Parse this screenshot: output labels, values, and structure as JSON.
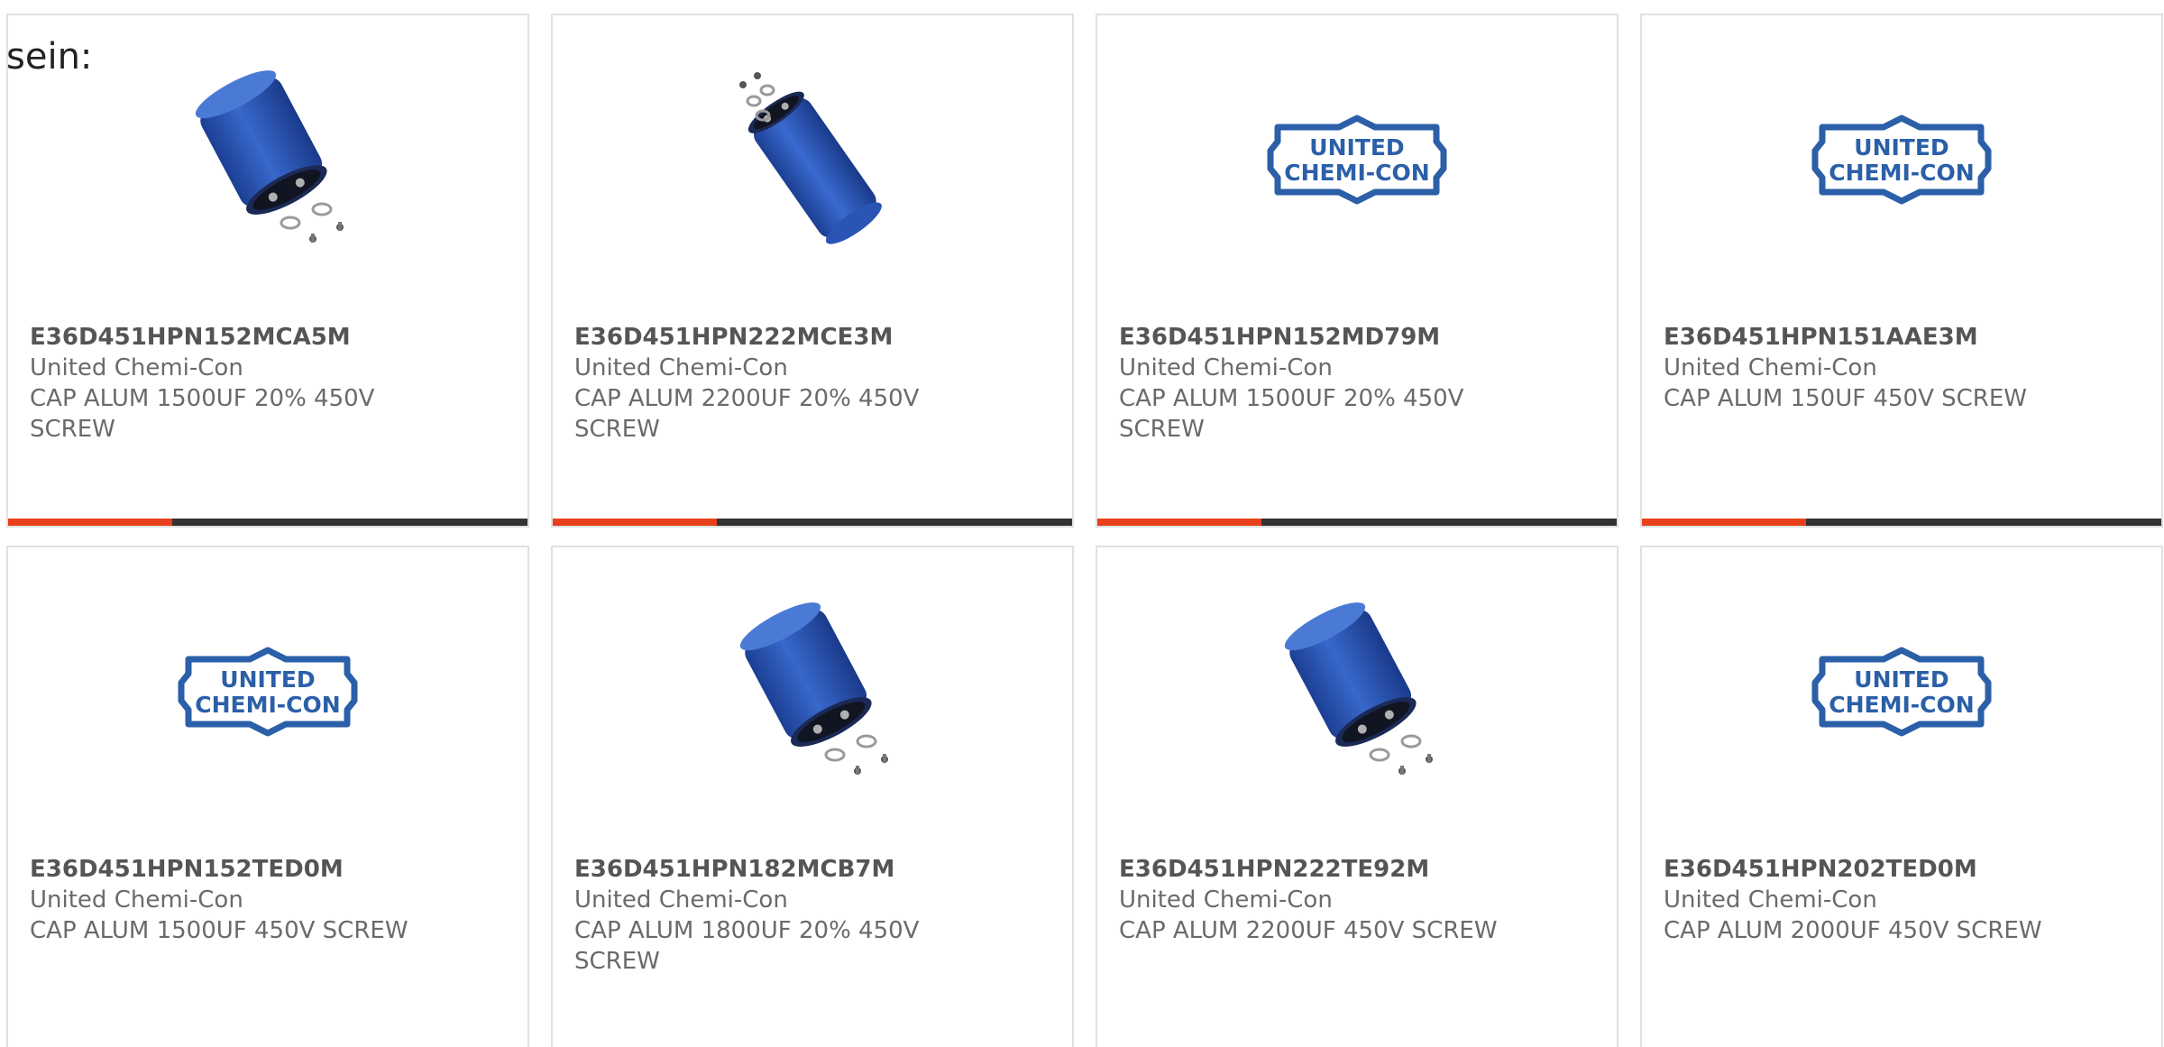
{
  "intro": "sein:",
  "colors": {
    "accent": "#e8401c",
    "bar_dark": "#333333",
    "capacitor_blue": "#2e5dbd",
    "logo_blue": "#2b5fa8"
  },
  "products": [
    {
      "part": "E36D451HPN152MCA5M",
      "maker": "United Chemi-Con",
      "desc": "CAP ALUM 1500UF 20% 450V SCREW",
      "image": "capacitor-with-screws-icon"
    },
    {
      "part": "E36D451HPN222MCE3M",
      "maker": "United Chemi-Con",
      "desc": "CAP ALUM 2200UF 20% 450V SCREW",
      "image": "tall-capacitor-icon"
    },
    {
      "part": "E36D451HPN152MD79M",
      "maker": "United Chemi-Con",
      "desc": "CAP ALUM 1500UF 20% 450V SCREW",
      "image": "united-chemi-con-logo"
    },
    {
      "part": "E36D451HPN151AAE3M",
      "maker": "United Chemi-Con",
      "desc": "CAP ALUM 150UF 450V SCREW",
      "image": "united-chemi-con-logo"
    },
    {
      "part": "E36D451HPN152TED0M",
      "maker": "United Chemi-Con",
      "desc": "CAP ALUM 1500UF 450V SCREW",
      "image": "united-chemi-con-logo"
    },
    {
      "part": "E36D451HPN182MCB7M",
      "maker": "United Chemi-Con",
      "desc": "CAP ALUM 1800UF 20% 450V SCREW",
      "image": "capacitor-with-screws-icon"
    },
    {
      "part": "E36D451HPN222TE92M",
      "maker": "United Chemi-Con",
      "desc": "CAP ALUM 2200UF 450V SCREW",
      "image": "capacitor-with-screws-icon"
    },
    {
      "part": "E36D451HPN202TED0M",
      "maker": "United Chemi-Con",
      "desc": "CAP ALUM 2000UF 450V SCREW",
      "image": "united-chemi-con-logo"
    }
  ],
  "logo": {
    "line1": "UNITED",
    "line2": "CHEMI-CON"
  }
}
